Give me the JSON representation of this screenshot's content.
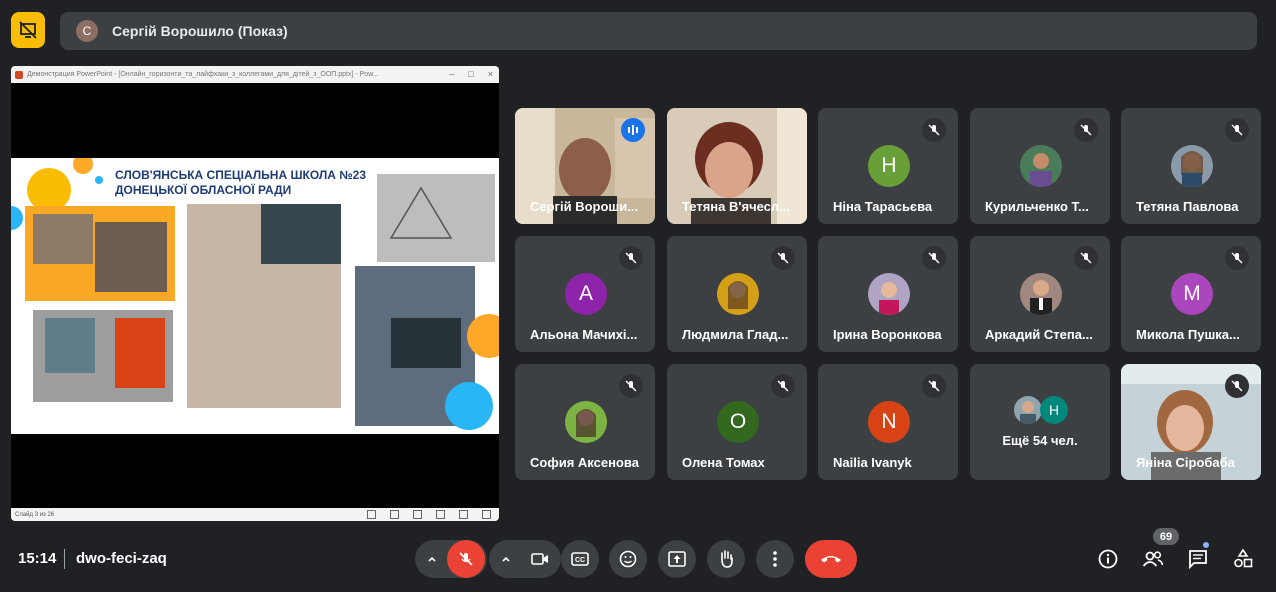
{
  "presenter": {
    "initial": "С",
    "label": "Сергій Ворошило (Показ)"
  },
  "presentation": {
    "window_title": "Демонстрация PowerPoint - [Онлайн_горизонти_та_лайфхаки_з_коллегами_для_дітей_з_ООП.pptx] - Pow...",
    "slide_title_line1": "СЛОВ'ЯНСЬКА СПЕЦІАЛЬНА ШКОЛА №23",
    "slide_title_line2": "ДОНЕЦЬКОЇ ОБЛАСНОЇ РАДИ",
    "status": "Слайд 3 из 26"
  },
  "participants": [
    {
      "name": "Сергій Вороши...",
      "type": "video",
      "speaking": true
    },
    {
      "name": "Тетяна В'ячесл...",
      "type": "video"
    },
    {
      "name": "Ніна Тарасьєва",
      "type": "letter",
      "letter": "Н",
      "color": "#689f38"
    },
    {
      "name": "Курильченко Т...",
      "type": "photo"
    },
    {
      "name": "Тетяна Павлова",
      "type": "photo"
    },
    {
      "name": "Альона Мачихі...",
      "type": "letter",
      "letter": "А",
      "color": "#8e24aa"
    },
    {
      "name": "Людмила Глад...",
      "type": "photo"
    },
    {
      "name": "Ірина Воронкова",
      "type": "photo"
    },
    {
      "name": "Аркадий Степа...",
      "type": "photo"
    },
    {
      "name": "Микола Пушка...",
      "type": "letter",
      "letter": "М",
      "color": "#ab47bc"
    },
    {
      "name": "София Аксенова",
      "type": "photo"
    },
    {
      "name": "Олена Томах",
      "type": "letter",
      "letter": "О",
      "color": "#33691e"
    },
    {
      "name": "Nailia Ivanyk",
      "type": "letter",
      "letter": "N",
      "color": "#d84315"
    },
    {
      "name": "Ещё 54 чел.",
      "type": "more",
      "letter": "Н"
    },
    {
      "name": "Яніна Сіробаба",
      "type": "video"
    }
  ],
  "footer": {
    "time": "15:14",
    "meeting_code": "dwo-feci-zaq",
    "participant_count": "69"
  },
  "colors": {
    "background": "#202124",
    "tile": "#3c4043",
    "accent": "#8ab4f8",
    "end_call": "#ea4335",
    "warning": "#fbbc04"
  }
}
